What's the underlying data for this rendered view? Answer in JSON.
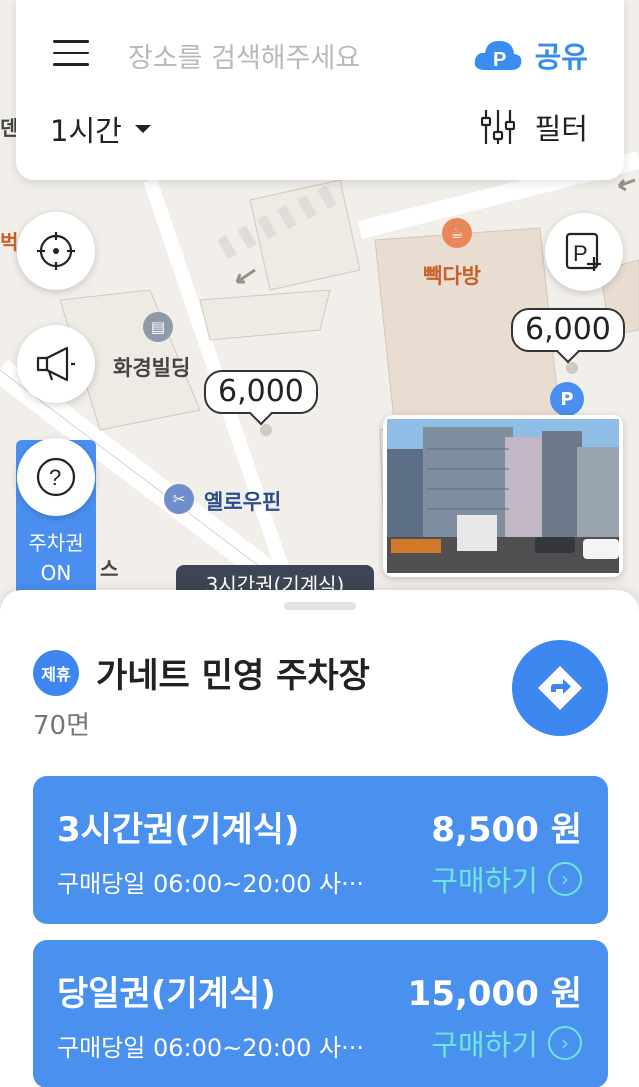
{
  "search": {
    "placeholder": "장소를 검색해주세요"
  },
  "share": {
    "label": "공유"
  },
  "time_select": {
    "label": "1시간"
  },
  "filter": {
    "label": "필터"
  },
  "map": {
    "pois": [
      {
        "label": "빽다방"
      },
      {
        "label": "화경빌딩"
      },
      {
        "label": "옐로우핀"
      },
      {
        "label": "덴"
      },
      {
        "label": "벅"
      },
      {
        "label": "스"
      }
    ],
    "price_bubbles": [
      "6,000",
      "6,000"
    ],
    "parking_marker": "P",
    "hidden_tag": "3시간권(기계식)"
  },
  "ticket_toggle": {
    "line1": "주차권",
    "line2": "ON"
  },
  "lot": {
    "badge": "제휴",
    "name": "가네트  민영 주차장",
    "spaces": "70면"
  },
  "tickets": [
    {
      "name": "3시간권(기계식)",
      "price": "8,500 원",
      "desc": "구매당일 06:00~20:00 사···",
      "buy": "구매하기"
    },
    {
      "name": "당일권(기계식)",
      "price": "15,000 원",
      "desc": "구매당일 06:00~20:00 사···",
      "buy": "구매하기"
    }
  ],
  "colors": {
    "accent": "#3e86ef",
    "card": "#4a90ef",
    "buy": "#6ee6e0"
  }
}
